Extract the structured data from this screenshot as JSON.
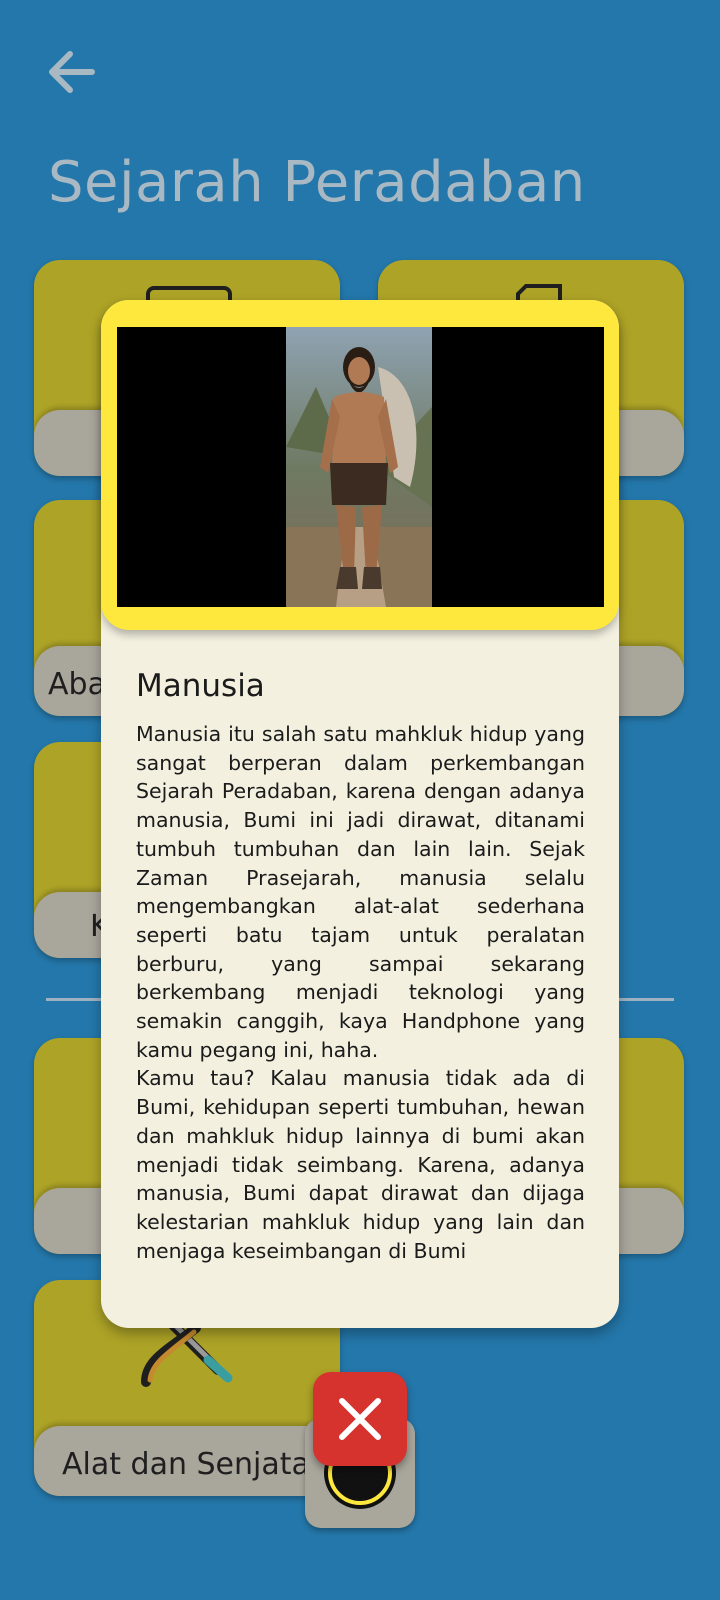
{
  "header": {
    "back_icon": "arrow-left-icon",
    "title": "Sejarah Peradaban"
  },
  "cards": [
    {
      "label": "",
      "icon": "scroll-icon"
    },
    {
      "label": "",
      "icon": "book-icon"
    },
    {
      "label": "Aba",
      "icon": ""
    },
    {
      "label": "",
      "icon": ""
    },
    {
      "label": "K",
      "icon": ""
    },
    {
      "label": "",
      "icon": ""
    },
    {
      "label": "",
      "icon": ""
    },
    {
      "label": "Alat dan Senjata",
      "icon": "weapons-icon"
    }
  ],
  "bottom_icon": "audio-toggle-icon",
  "modal": {
    "image": "caveman-portrait",
    "title": "Manusia",
    "paragraph1": "Manusia itu salah satu mahkluk hidup yang sangat berperan dalam perkembangan Sejarah Peradaban, karena dengan adanya manusia, Bumi ini jadi dirawat, ditanami tumbuh tumbuhan dan lain lain. Sejak Zaman Prasejarah, manusia selalu mengembangkan alat-alat sederhana seperti batu tajam untuk peralatan berburu, yang sampai sekarang berkembang menjadi teknologi yang semakin canggih, kaya Handphone yang kamu pegang ini, haha.",
    "paragraph2": "Kamu tau? Kalau manusia tidak ada di Bumi, kehidupan seperti tumbuhan, hewan dan mahkluk hidup lainnya di bumi akan menjadi tidak seimbang. Karena, adanya manusia, Bumi dapat dirawat dan dijaga kelestarian mahkluk hidup yang lain dan menjaga keseimbangan di Bumi",
    "close_icon": "close-icon"
  },
  "colors": {
    "background": "#2477aa",
    "card": "#ada327",
    "card_band": "#a9a69c",
    "modal": "#f3f0e0",
    "media_frame": "#ffe83d",
    "close_button": "#d6322e"
  }
}
